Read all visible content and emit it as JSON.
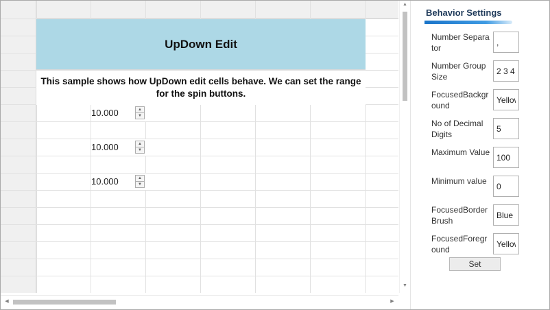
{
  "grid": {
    "title": "UpDown Edit",
    "description": "This sample shows how UpDown edit cells behave. We can set the range for the spin buttons.",
    "updown_cells": [
      {
        "value": "10.000"
      },
      {
        "value": "10.000"
      },
      {
        "value": "10.000"
      }
    ],
    "spin_up_glyph": "▲",
    "spin_down_glyph": "▼"
  },
  "scrollbars": {
    "up_glyph": "▲",
    "down_glyph": "▼",
    "left_glyph": "◀",
    "right_glyph": "▶"
  },
  "panel": {
    "title": "Behavior Settings",
    "accent_color": "#1a74c9",
    "settings": [
      {
        "label": "Number Separator",
        "value": ","
      },
      {
        "label": "Number Group Size",
        "value": "2 3 4"
      },
      {
        "label": "FocusedBackground",
        "value": "Yellow"
      },
      {
        "label": "No of Decimal Digits",
        "value": "5"
      },
      {
        "label": "Maximum Value",
        "value": "100"
      },
      {
        "label": "Minimum value",
        "value": "0"
      },
      {
        "label": "FocusedBorderBrush",
        "value": "Blue"
      },
      {
        "label": "FocusedForeground",
        "value": "Yellow"
      }
    ],
    "set_label": "Set"
  },
  "colors": {
    "title_cell_bg": "#add8e6",
    "header_bg": "#f0f0f0"
  }
}
